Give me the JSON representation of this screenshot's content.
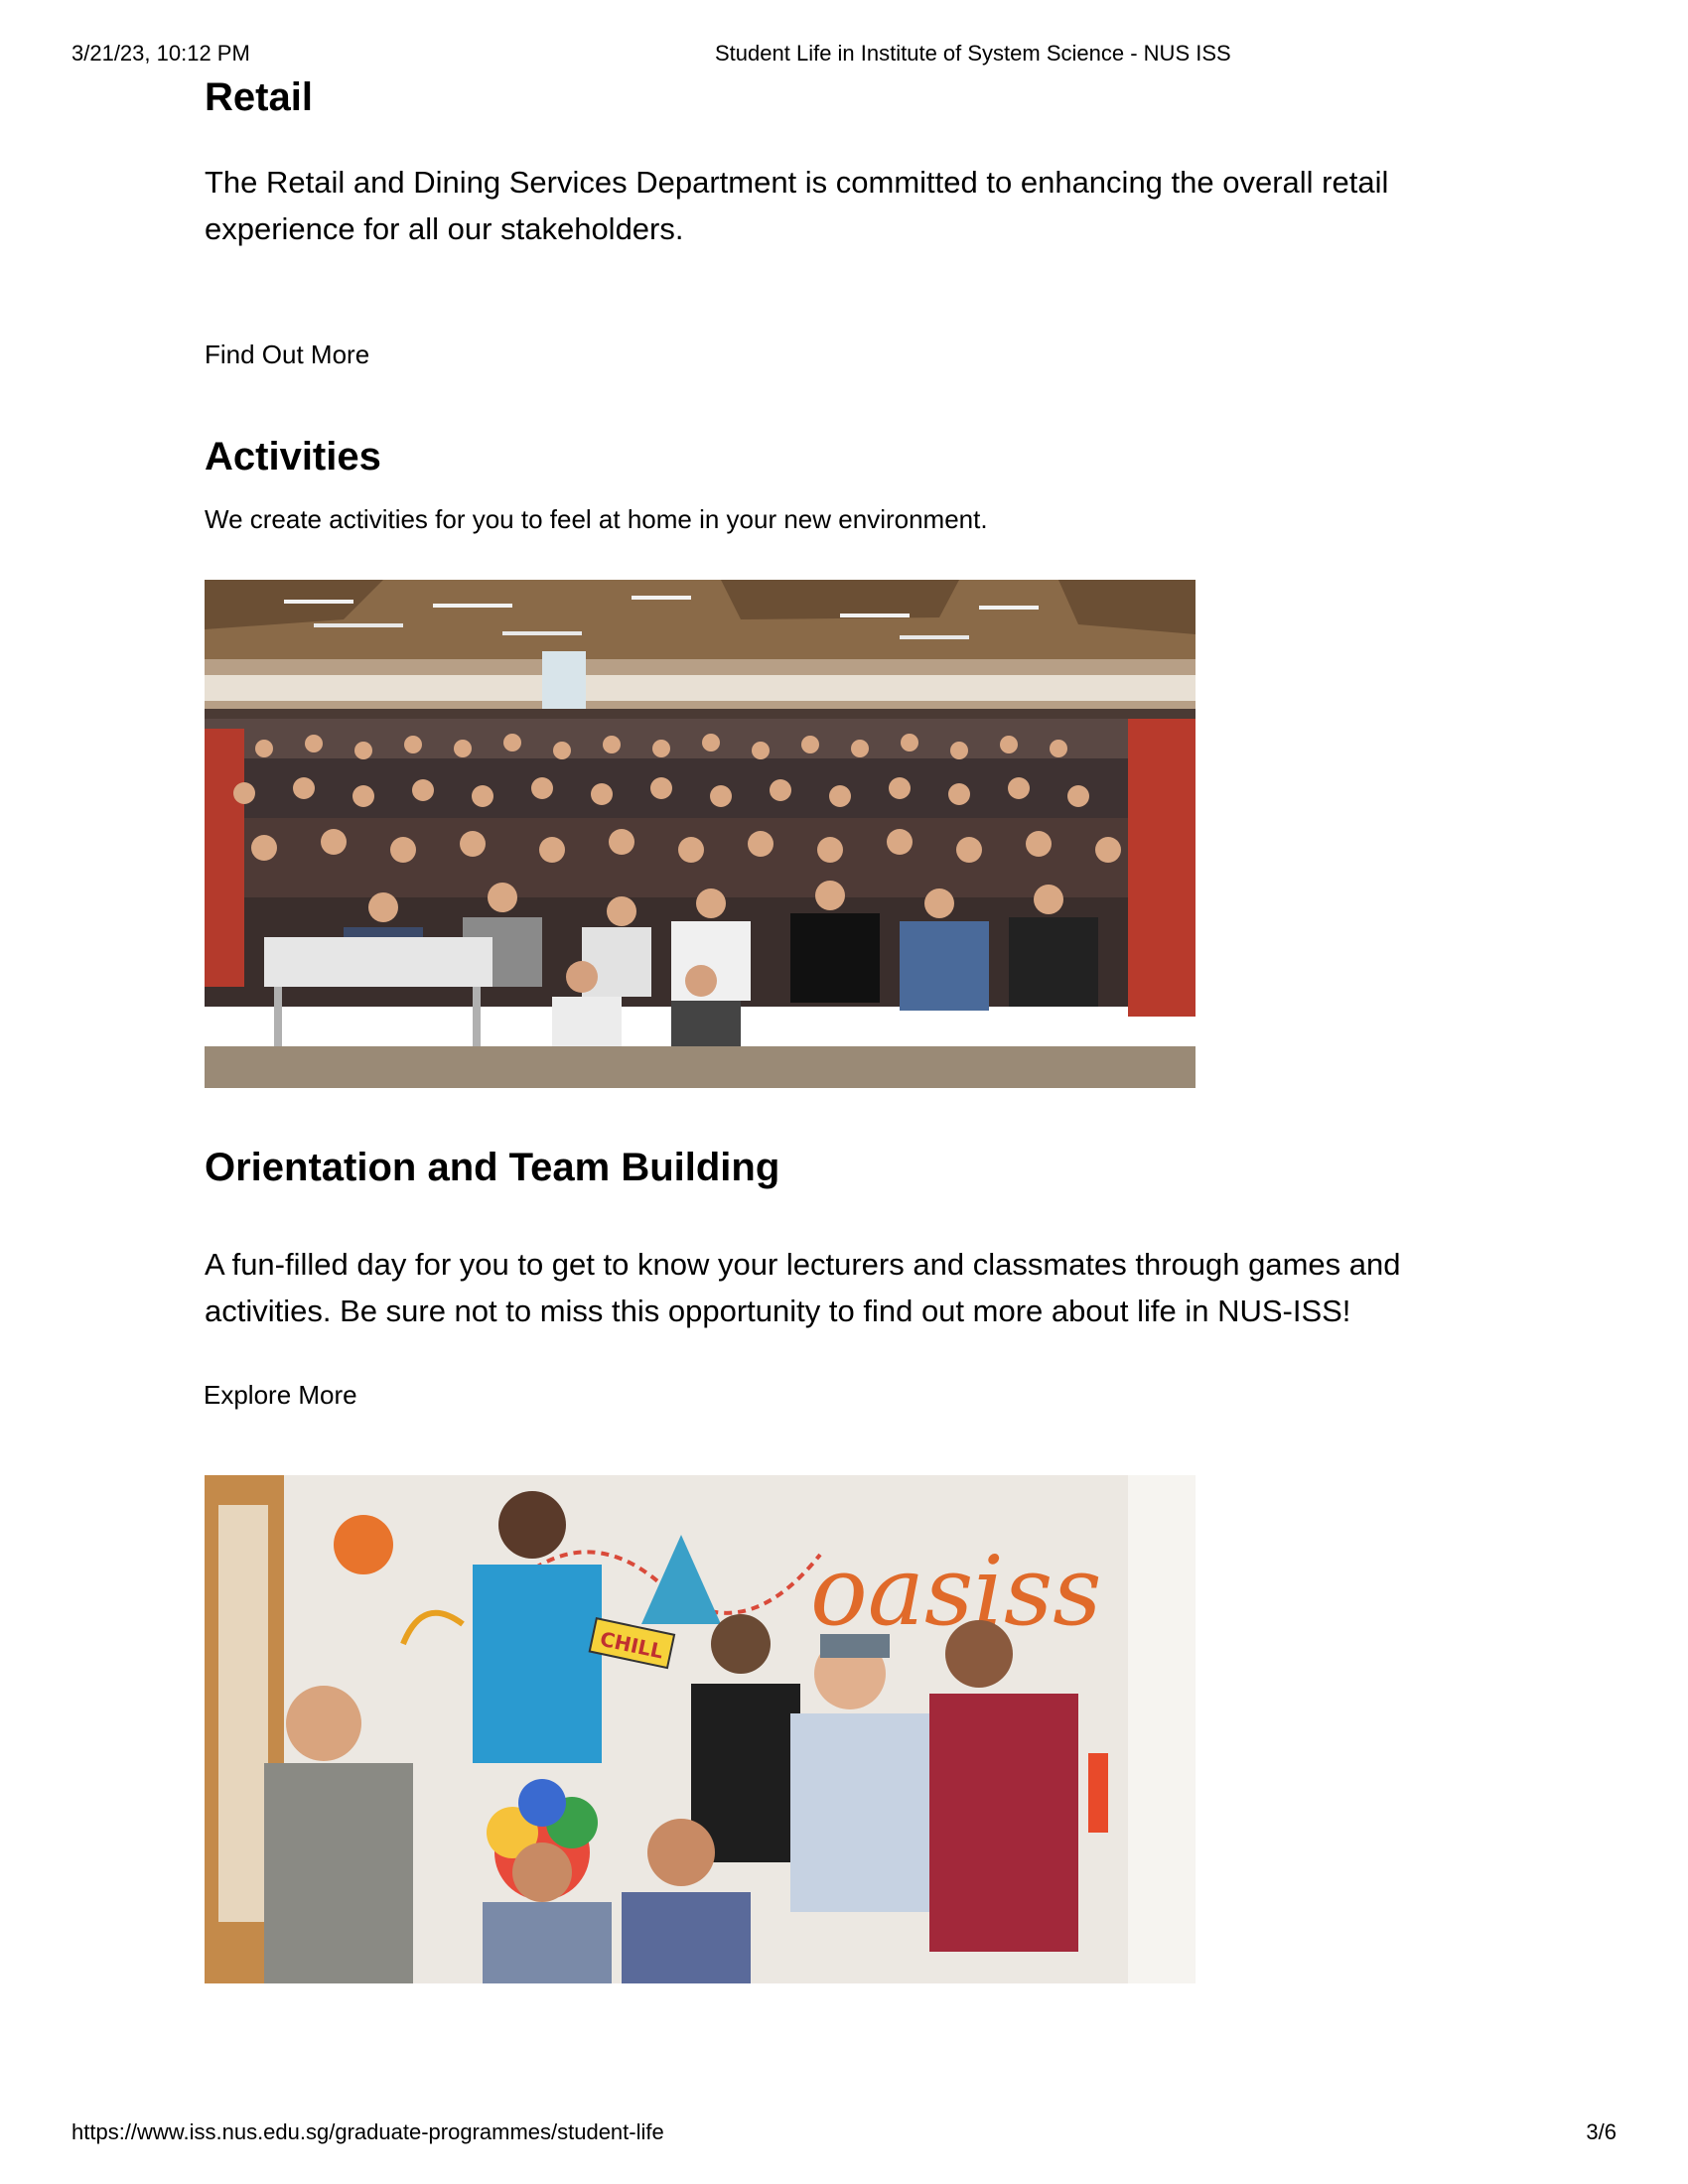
{
  "print_header": {
    "datetime": "3/21/23, 10:12 PM",
    "title": "Student Life in Institute of System Science - NUS ISS"
  },
  "sections": {
    "retail": {
      "heading": "Retail",
      "body": "The Retail and Dining Services Department is committed to enhancing the overall retail experience for all our stakeholders.",
      "link": "Find Out More"
    },
    "activities": {
      "heading": "Activities",
      "body": "We create activities for you to feel at home in your new environment."
    },
    "orientation": {
      "heading": "Orientation and Team Building",
      "body": "A fun-filled day for you to get to know your lecturers and classmates through games and activities. Be sure not to miss this opportunity to find out more about life in NUS-ISS!",
      "link": "Explore More"
    }
  },
  "photos": {
    "group_photo_wall_text": "oasiss",
    "group_photo_sign_text": "CHILL"
  },
  "print_footer": {
    "url": "https://www.iss.nus.edu.sg/graduate-programmes/student-life",
    "page": "3/6"
  }
}
